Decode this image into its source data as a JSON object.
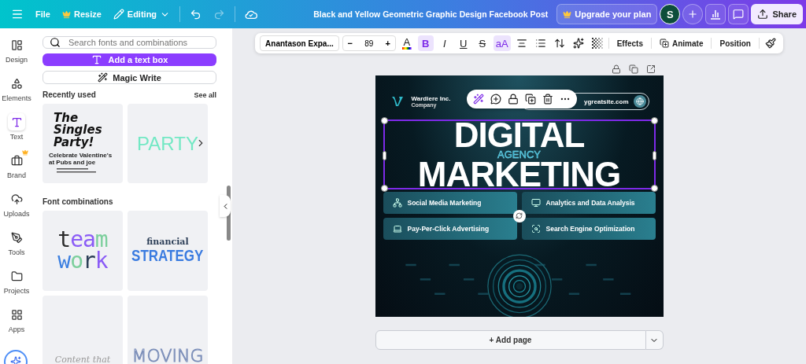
{
  "topbar": {
    "menu": [
      "File",
      "Resize"
    ],
    "mode": "Editing",
    "redo_disabled": true,
    "title": "Black and Yellow Geometric Graphic Design Facebook Post",
    "upgrade": "Upgrade your plan",
    "avatar": "S",
    "share": "Share"
  },
  "sidebar": {
    "items": [
      {
        "label": "Design",
        "selected": false
      },
      {
        "label": "Elements",
        "selected": false
      },
      {
        "label": "Text",
        "selected": true
      },
      {
        "label": "Brand",
        "selected": false
      },
      {
        "label": "Uploads",
        "selected": false
      },
      {
        "label": "Tools",
        "selected": false
      },
      {
        "label": "Projects",
        "selected": false
      },
      {
        "label": "Apps",
        "selected": false
      }
    ]
  },
  "panel": {
    "search": {
      "placeholder": "Search fonts and combinations"
    },
    "add_text": "Add a text box",
    "magic_write": "Magic Write",
    "recent": {
      "title": "Recently used",
      "see_all": "See all",
      "cards": [
        {
          "kind": "poster",
          "lines": [
            "The Singles Party!",
            "Celebrate Valentine's at Pubs and joe"
          ]
        },
        {
          "kind": "word",
          "lines": [
            "PARTY"
          ]
        }
      ]
    },
    "combos": {
      "title": "Font combinations",
      "cards": [
        {
          "kind": "multicolor",
          "lines": [
            "team",
            "work"
          ]
        },
        {
          "kind": "serif_sans",
          "lines": [
            "financial",
            "STRATEGY"
          ]
        },
        {
          "kind": "script",
          "lines": [
            "Content that"
          ]
        },
        {
          "kind": "outline",
          "lines": [
            "MOVING"
          ]
        }
      ]
    }
  },
  "text_toolbar": {
    "font": "Anantason Expa...",
    "minus": "−",
    "size": "89",
    "plus": "+",
    "tools": [
      {
        "kind": "color",
        "label": "A",
        "selected": false
      },
      {
        "kind": "bold",
        "label": "B",
        "selected": true
      },
      {
        "kind": "italic",
        "label": "I",
        "selected": false
      },
      {
        "kind": "underline",
        "label": "U",
        "selected": false
      },
      {
        "kind": "strike",
        "label": "S",
        "selected": false
      },
      {
        "kind": "case",
        "label": "aA",
        "selected": true
      },
      {
        "kind": "align",
        "selected": false
      },
      {
        "kind": "list",
        "selected": false
      },
      {
        "kind": "spacing",
        "selected": false
      },
      {
        "kind": "font_effect",
        "selected": false
      },
      {
        "kind": "transparency",
        "selected": false
      }
    ],
    "actions": [
      "Effects",
      "Animate",
      "Position"
    ]
  },
  "design": {
    "brand": "Wardiere Inc.",
    "brand_sub": "Company",
    "url": "ygreatsite.com",
    "headline": [
      "DIGITAL",
      "MARKETING"
    ],
    "overlay": "AGENCY",
    "services": [
      "Social Media Marketing",
      "Analytics and Data Analysis",
      "Pay-Per-Click Advertising",
      "Search Engine Optimization"
    ]
  },
  "add_page": "+ Add page"
}
